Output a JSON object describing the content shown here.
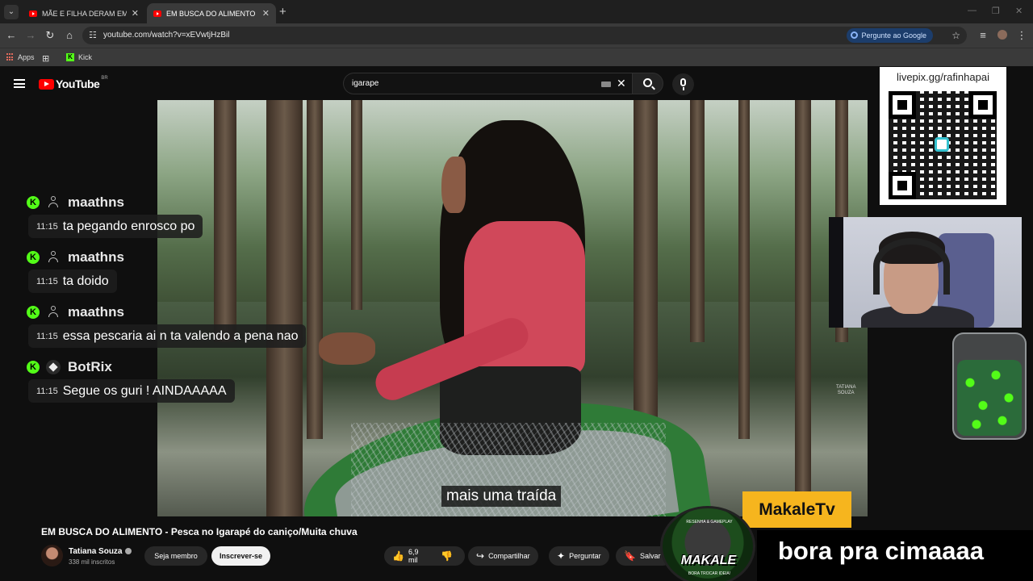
{
  "browser": {
    "tabs": [
      {
        "title": "MÃE E FILHA DERAM EM CIMA",
        "active": false
      },
      {
        "title": "EM BUSCA DO ALIMENTO - Pes",
        "active": true
      }
    ],
    "url": "youtube.com/watch?v=xEVwtjHzBil",
    "ask_google_label": "Pergunte ao Google",
    "bookmarks": [
      {
        "label": "Apps"
      },
      {
        "label": "Kick"
      }
    ]
  },
  "youtube": {
    "logo_text": "YouTube",
    "region": "BR",
    "search_query": "igarape"
  },
  "video": {
    "subtitle": "mais uma traída",
    "watermark_line1": "TATIANA",
    "watermark_line2": "SOUZA",
    "title": "EM BUSCA DO ALIMENTO - Pesca no Igarapé do caniço/Muita chuva"
  },
  "channel": {
    "name": "Tatiana Souza",
    "subscribers": "338 mil inscritos",
    "member_label": "Seja membro",
    "subscribe_label": "Inscrever-se"
  },
  "actions": {
    "likes": "6,9 mil",
    "share": "Compartilhar",
    "ask": "Perguntar",
    "save": "Salvar"
  },
  "chat": [
    {
      "user": "maathns",
      "time": "11:15",
      "text": "ta pegando enrosco po",
      "bot": false
    },
    {
      "user": "maathns",
      "time": "11:15",
      "text": "ta doido",
      "bot": false
    },
    {
      "user": "maathns",
      "time": "11:15",
      "text": "essa pescaria ai n ta valendo a pena nao",
      "bot": false
    },
    {
      "user": "BotRix",
      "time": "11:15",
      "text": "Segue os guri ! AINDAAAAA",
      "bot": true
    }
  ],
  "overlay": {
    "livepix_link": "livepix.gg/rafinhapai",
    "brand_label": "MakaleTv",
    "banner_text": "bora pra cimaaaa",
    "logo_text": "MAKALE",
    "logo_top": "RESENHA & GAMEPLAY",
    "logo_bottom": "BORA TROCAR IDEIA!"
  },
  "colors": {
    "kick_green": "#53fc18",
    "youtube_red": "#ff0000",
    "overlay_gold": "#f6b51e"
  }
}
